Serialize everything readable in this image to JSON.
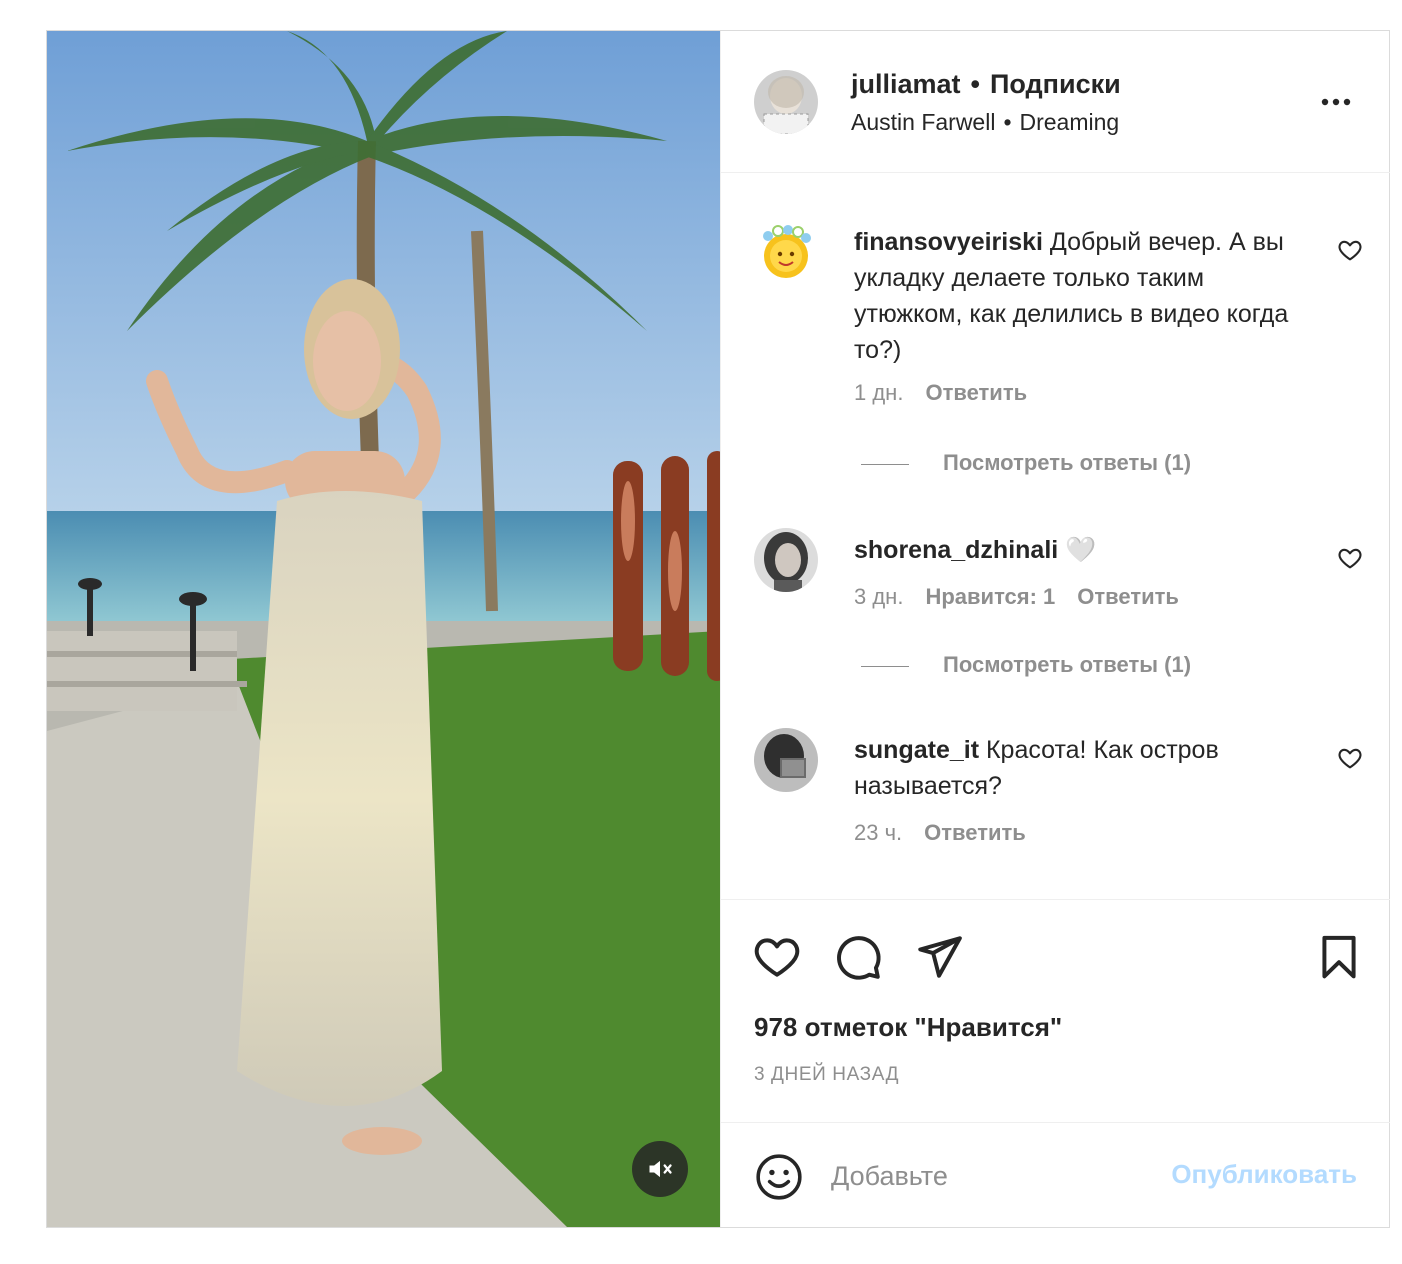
{
  "header": {
    "username": "julliamat",
    "dot": "•",
    "follow_label": "Подписки",
    "audio_artist": "Austin Farwell",
    "audio_track": "Dreaming",
    "more_icon": "more-horizontal-icon"
  },
  "media": {
    "mute_icon": "speaker-muted-icon"
  },
  "comments": [
    {
      "username": "finansovyeiriski",
      "text": " Добрый вечер. А вы укладку делаете только таким утюжком, как делились в видео когда то?)",
      "time": "1 дн.",
      "likes": "",
      "reply_label": "Ответить",
      "view_replies": "Посмотреть ответы (1)"
    },
    {
      "username": "shorena_dzhinali",
      "text": " 🤍",
      "time": "3 дн.",
      "likes": "Нравится: 1",
      "reply_label": "Ответить",
      "view_replies": "Посмотреть ответы (1)"
    },
    {
      "username": "sungate_it",
      "text": " Красота! Как остров называется?",
      "time": "23 ч.",
      "likes": "",
      "reply_label": "Ответить",
      "view_replies": ""
    }
  ],
  "actions": {
    "icons": [
      "heart-icon",
      "comment-icon",
      "share-icon",
      "bookmark-icon"
    ],
    "likes_text": "978 отметок \"Нравится\"",
    "date_text": "3 ДНЕЙ НАЗАД"
  },
  "add_comment": {
    "placeholder": "Добавьте",
    "publish_label": "Опубликовать",
    "publish_color": "#b3dbff"
  },
  "colors": {
    "text": "#262626",
    "muted": "#8e8e8e",
    "border": "#dbdbdb"
  }
}
